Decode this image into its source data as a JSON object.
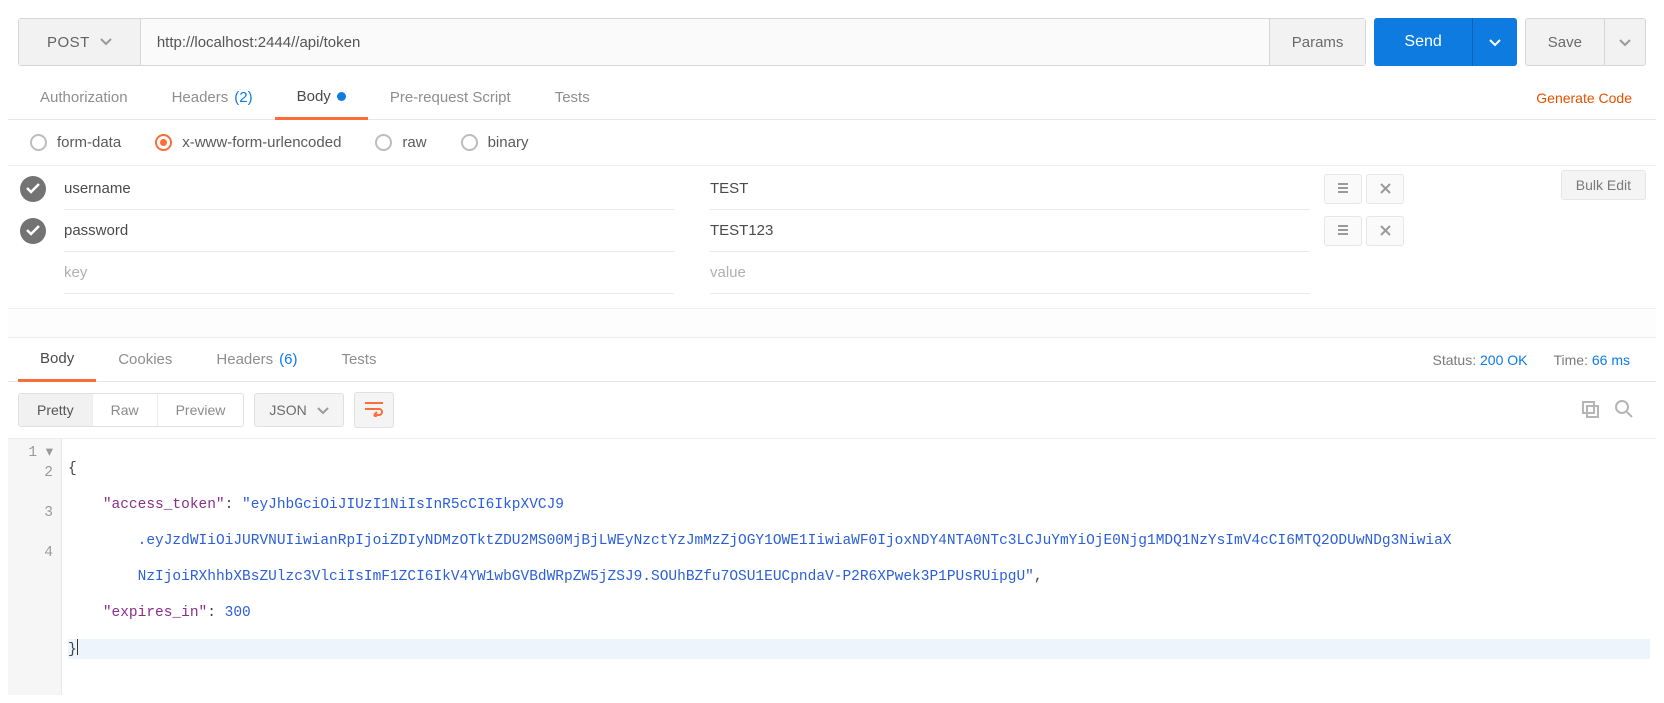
{
  "request": {
    "method": "POST",
    "url": "http://localhost:2444//api/token",
    "params_btn": "Params",
    "send": "Send",
    "save": "Save"
  },
  "req_tabs": {
    "authorization": "Authorization",
    "headers": "Headers",
    "headers_count": "(2)",
    "body": "Body",
    "pre_request": "Pre-request Script",
    "tests": "Tests",
    "generate_code": "Generate Code",
    "active": "body"
  },
  "body_types": {
    "selected": "x-www-form-urlencoded",
    "form_data": "form-data",
    "x_www": "x-www-form-urlencoded",
    "raw": "raw",
    "binary": "binary"
  },
  "form_rows": [
    {
      "enabled": true,
      "key": "username",
      "value": "TEST"
    },
    {
      "enabled": true,
      "key": "password",
      "value": "TEST123"
    }
  ],
  "form_placeholders": {
    "key": "key",
    "value": "value"
  },
  "bulk_edit": "Bulk Edit",
  "resp_tabs": {
    "body": "Body",
    "cookies": "Cookies",
    "headers": "Headers",
    "headers_count": "(6)",
    "tests": "Tests",
    "active": "body"
  },
  "resp_meta": {
    "status_label": "Status:",
    "status_value": "200 OK",
    "time_label": "Time:",
    "time_value": "66 ms"
  },
  "viewer": {
    "pretty": "Pretty",
    "raw": "Raw",
    "preview": "Preview",
    "format": "JSON"
  },
  "response_json": {
    "access_token_key": "\"access_token\"",
    "access_token_val1": "\"eyJhbGciOiJIUzI1NiIsInR5cCI6IkpXVCJ9",
    "access_token_val2": ".eyJzdWIiOiJURVNUIiwianRpIjoiZDIyNDMzOTktZDU2MS00MjBjLWEyNzctYzJmMzZjOGY1OWE1IiwiaWF0IjoxNDY4NTA0NTc3LCJuYmYiOjE0Njg1MDQ1NzYsImV4cCI6MTQ2ODUwNDg3NiwiaX",
    "access_token_val3": "NzIjoiRXhhbXBsZUlzc3VlciIsImF1ZCI6IkV4YW1wbGVBdWRpZW5jZSJ9.SOUhBZfu7OSU1EUCpndaV-P2R6XPwek3P1PUsRUipgU\"",
    "expires_in_key": "\"expires_in\"",
    "expires_in_val": "300"
  },
  "gutter": {
    "l1": "1 ▾",
    "l2": "2",
    "l3": "3",
    "l4": "4"
  }
}
